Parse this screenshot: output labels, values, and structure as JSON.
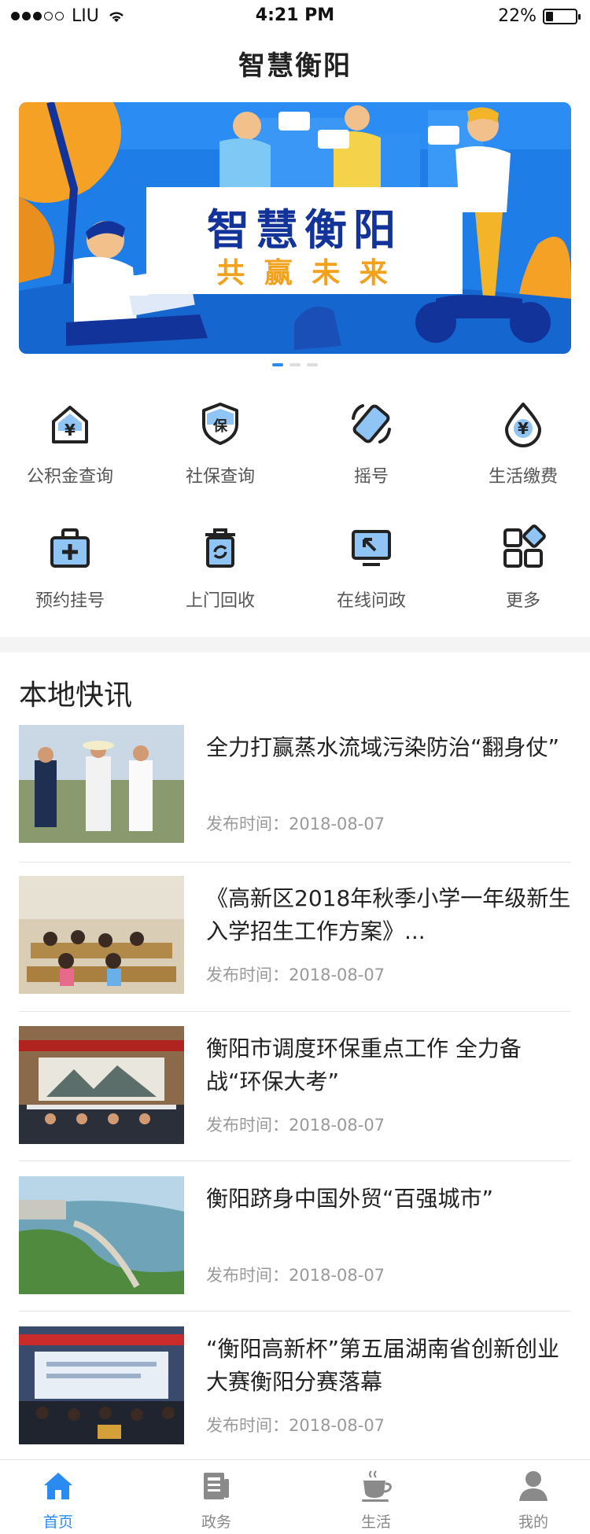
{
  "status_bar": {
    "carrier": "LIU",
    "time": "4:21 PM",
    "battery": "22%"
  },
  "page_title": "智慧衡阳",
  "banner": {
    "title": "智慧衡阳",
    "subtitle": "共 赢 未 来"
  },
  "services": [
    {
      "label": "公积金查询",
      "icon": "house-yuan-icon"
    },
    {
      "label": "社保查询",
      "icon": "shield-bao-icon"
    },
    {
      "label": "摇号",
      "icon": "phone-shake-icon"
    },
    {
      "label": "生活缴费",
      "icon": "drop-yuan-icon"
    },
    {
      "label": "预约挂号",
      "icon": "medical-kit-icon"
    },
    {
      "label": "上门回收",
      "icon": "recycle-bin-icon"
    },
    {
      "label": "在线问政",
      "icon": "monitor-icon"
    },
    {
      "label": "更多",
      "icon": "grid-more-icon"
    }
  ],
  "section_title": "本地快讯",
  "date_label": "发布时间：",
  "news": [
    {
      "headline": "全力打赢蒸水流域污染防治“翻身仗”",
      "date": "2018-08-07"
    },
    {
      "headline": "《高新区2018年秋季小学一年级新生入学招生工作方案》...",
      "date": "2018-08-07"
    },
    {
      "headline": "衡阳市调度环保重点工作 全力备战“环保大考”",
      "date": "2018-08-07"
    },
    {
      "headline": "衡阳跻身中国外贸“百强城市”",
      "date": "2018-08-07"
    },
    {
      "headline": "“衡阳高新杯”第五届湖南省创新创业大赛衡阳分赛落幕",
      "date": "2018-08-07"
    }
  ],
  "tabs": [
    {
      "label": "首页",
      "icon": "home-icon"
    },
    {
      "label": "政务",
      "icon": "document-icon"
    },
    {
      "label": "生活",
      "icon": "coffee-icon"
    },
    {
      "label": "我的",
      "icon": "user-icon"
    }
  ],
  "colors": {
    "accent": "#2a8bf2",
    "banner_blue": "#1f7de8",
    "banner_title": "#12349a",
    "banner_subtitle": "#f2a11c"
  }
}
